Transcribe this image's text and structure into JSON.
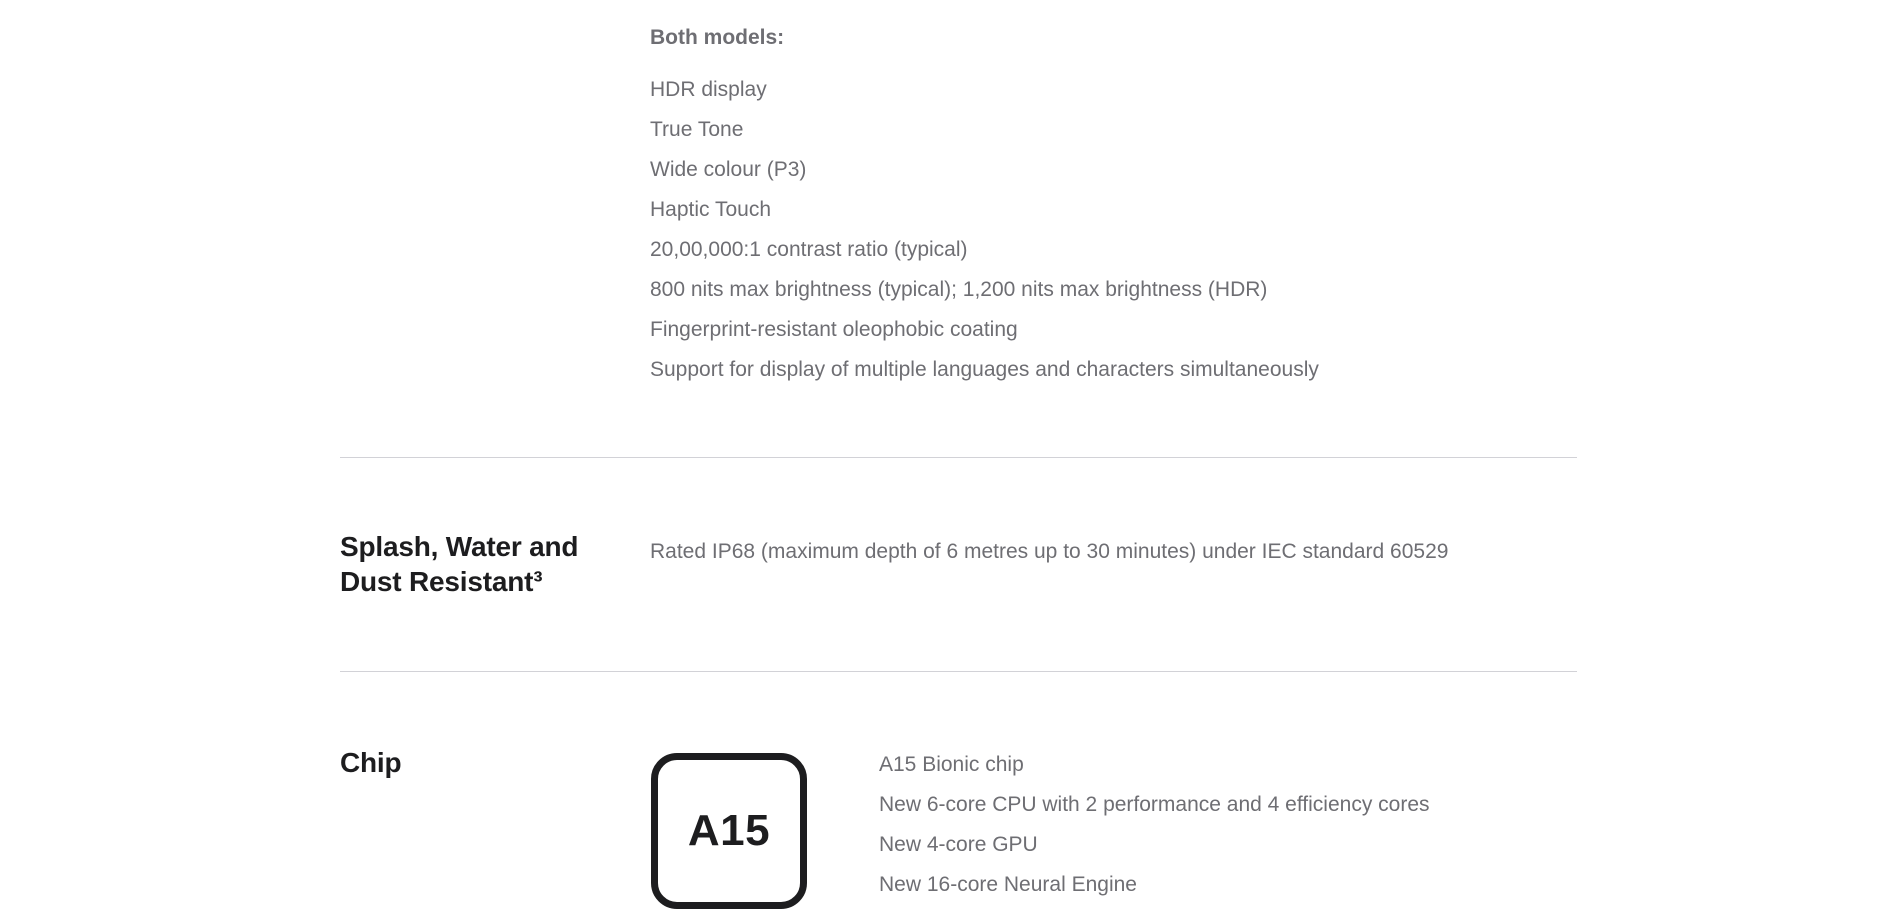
{
  "display": {
    "subhead": "Both models:",
    "items": [
      "HDR display",
      "True Tone",
      "Wide colour (P3)",
      "Haptic Touch",
      "20,00,000:1 contrast ratio (typical)",
      "800 nits max brightness (typical); 1,200 nits max brightness (HDR)",
      "Fingerprint-resistant oleophobic coating",
      "Support for display of multiple languages and characters simultaneously"
    ]
  },
  "water": {
    "heading_line1": "Splash, Water and",
    "heading_line2": "Dust Resistant³",
    "text": "Rated IP68 (maximum depth of 6 metres up to 30 minutes) under IEC standard 60529"
  },
  "chip": {
    "heading": "Chip",
    "icon_label": "A15",
    "icon_name": "a15-chip-icon",
    "items": [
      "A15 Bionic chip",
      "New 6-core CPU with 2 performance and 4 efficiency cores",
      "New 4-core GPU",
      "New 16-core Neural Engine"
    ]
  },
  "colors": {
    "heading": "#1d1d1f",
    "body_text": "#6e6e73",
    "divider": "#d2d2d7",
    "background": "#ffffff"
  }
}
